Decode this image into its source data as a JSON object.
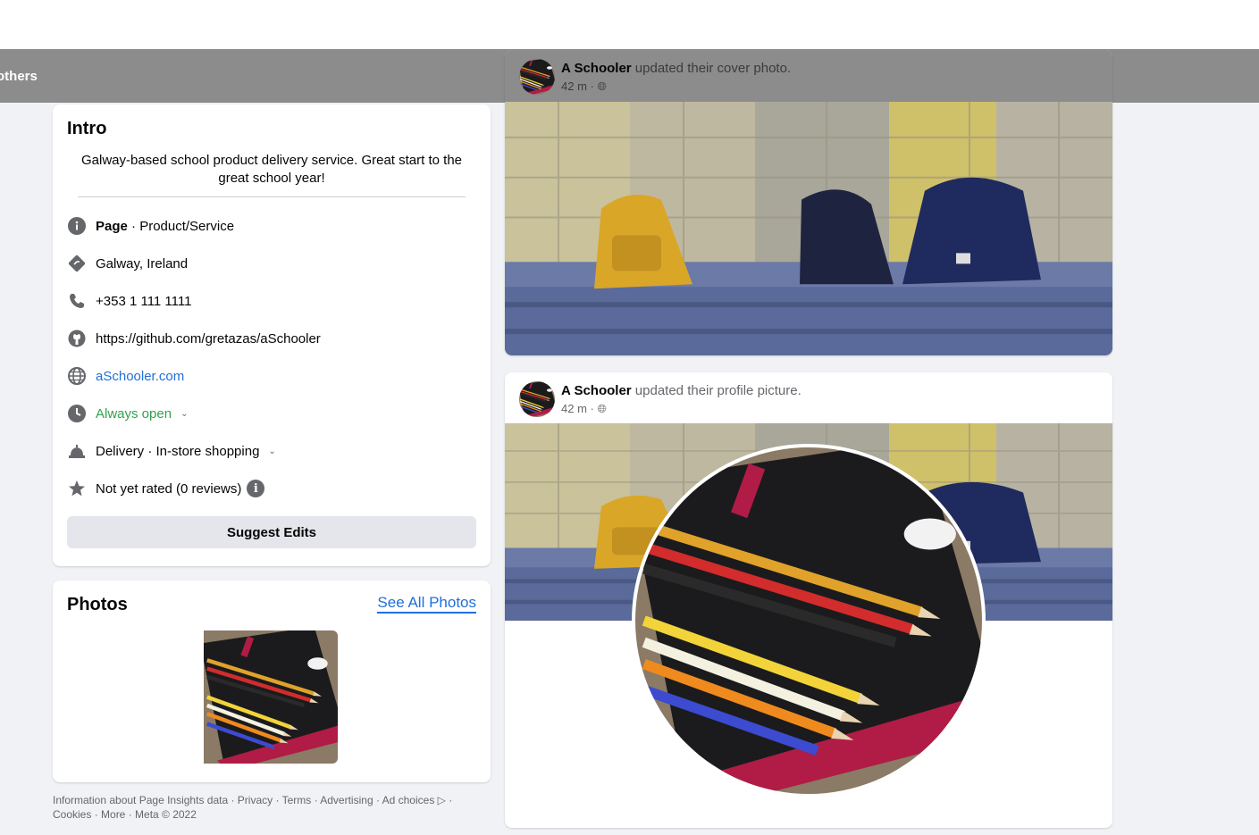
{
  "header": {
    "others_text": "others"
  },
  "intro": {
    "title": "Intro",
    "bio": "Galway-based school product delivery service. Great start to the great school year!",
    "page_label": "Page",
    "page_category": " · Product/Service",
    "location": "Galway, Ireland",
    "phone": "+353 1 111 1111",
    "github": "https://github.com/gretazas/aSchooler",
    "website": "aSchooler.com",
    "hours": "Always open",
    "services": "Delivery · In-store shopping",
    "rating": "Not yet rated (0 reviews)",
    "suggest_button": "Suggest Edits"
  },
  "photos": {
    "title": "Photos",
    "see_all": "See All Photos"
  },
  "footer": {
    "line1": "Information about Page Insights data · Privacy · Terms · Advertising · Ad choices ▷ ·",
    "line2": "Cookies · More · Meta © 2022"
  },
  "posts": [
    {
      "author": "A Schooler",
      "action": " updated their cover photo.",
      "time": "42 m ·"
    },
    {
      "author": "A Schooler",
      "action": " updated their profile picture.",
      "time": "42 m ·"
    }
  ],
  "colors": {
    "accent": "#216fdb",
    "open_green": "#31a24c",
    "overlay": "#8c8c8c"
  }
}
